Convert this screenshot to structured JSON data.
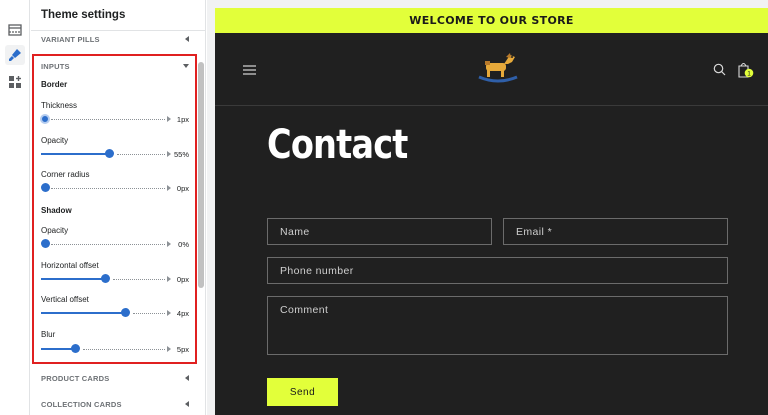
{
  "panel": {
    "title": "Theme settings",
    "sections_before": [
      {
        "label": "VARIANT PILLS"
      }
    ],
    "inputs_section": {
      "label": "INPUTS",
      "border_heading": "Border",
      "shadow_heading": "Shadow",
      "border_sliders": [
        {
          "label": "Thickness",
          "value": "1px",
          "level": 0.0
        },
        {
          "label": "Opacity",
          "value": "55%",
          "level": 0.55
        },
        {
          "label": "Corner radius",
          "value": "0px",
          "level": 0.0
        }
      ],
      "shadow_sliders": [
        {
          "label": "Opacity",
          "value": "0%",
          "level": 0.0
        },
        {
          "label": "Horizontal offset",
          "value": "0px",
          "level": 0.5
        },
        {
          "label": "Vertical offset",
          "value": "4px",
          "level": 0.7
        },
        {
          "label": "Blur",
          "value": "5px",
          "level": 0.25
        }
      ]
    },
    "sections_after": [
      {
        "label": "PRODUCT CARDS"
      },
      {
        "label": "COLLECTION CARDS"
      }
    ]
  },
  "store": {
    "announcement": "WELCOME TO OUR STORE",
    "cart_count": "1",
    "page_title": "Contact",
    "form": {
      "name_placeholder": "Name",
      "email_placeholder": "Email *",
      "phone_placeholder": "Phone number",
      "comment_placeholder": "Comment",
      "send_label": "Send"
    }
  },
  "colors": {
    "accent": "#e2ff3a",
    "store_bg": "#202020",
    "slider": "#2c6ecb",
    "highlight": "#e02020"
  },
  "icons": [
    "sections-icon",
    "theme-settings-brush-icon",
    "apps-add-icon",
    "menu-icon",
    "rocking-horse-logo",
    "search-icon",
    "cart-icon"
  ]
}
